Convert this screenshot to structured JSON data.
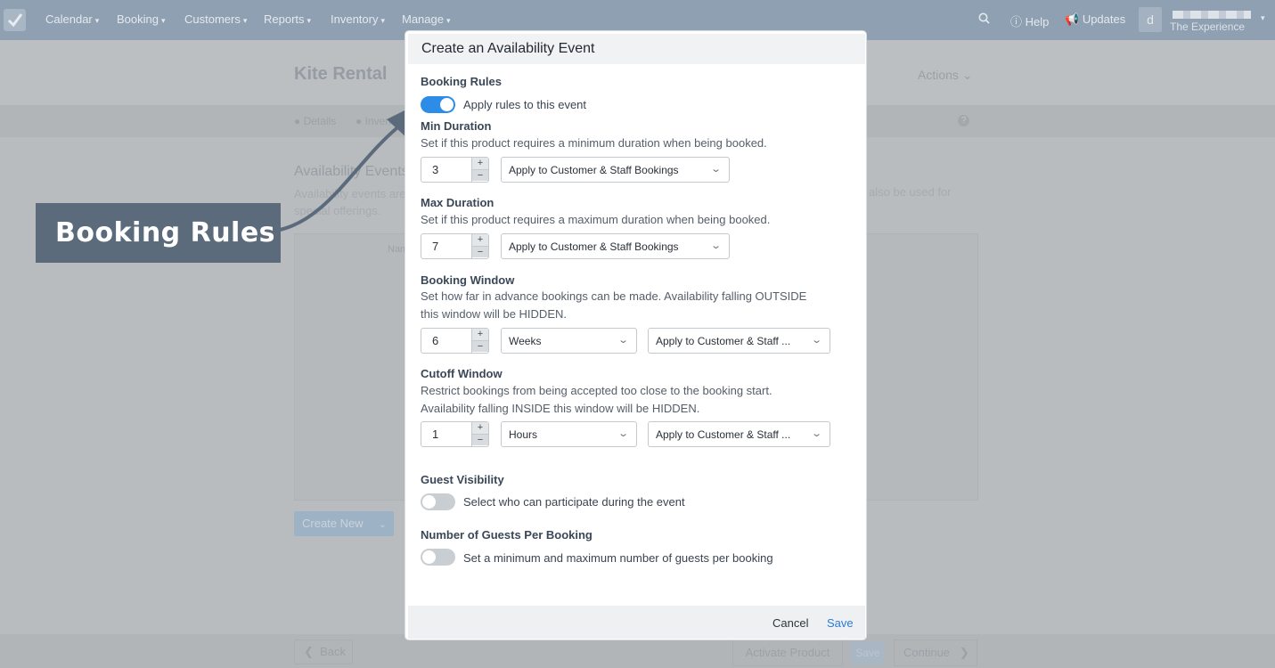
{
  "nav": {
    "items": [
      {
        "label": "Calendar"
      },
      {
        "label": "Booking"
      },
      {
        "label": "Customers"
      },
      {
        "label": "Reports"
      },
      {
        "label": "Inventory"
      },
      {
        "label": "Manage"
      }
    ],
    "help_label": "Help",
    "updates_label": "Updates",
    "avatar_letter": "d",
    "user_subtitle": "The Experience"
  },
  "background": {
    "title": "Kite Rental",
    "actions_label": "Actions",
    "steps": [
      "Details",
      "Inven"
    ],
    "section_title": "Availability Events",
    "description_lines": [
      "Availability events are",
      "special offerings."
    ],
    "description_right": "also be used for",
    "column_label": "Nam",
    "create_new_label": "Create New",
    "back_label": "Back",
    "activate_label": "Activate Product",
    "save_label": "Save",
    "continue_label": "Continue"
  },
  "callout": {
    "text": "Booking Rules",
    "color": "#5b6b7c"
  },
  "modal": {
    "title": "Create an Availability Event",
    "booking_rules": {
      "heading": "Booking Rules",
      "toggle_on": true,
      "toggle_label": "Apply rules to this event"
    },
    "min_duration": {
      "heading": "Min Duration",
      "description": "Set if this product requires a minimum duration when being booked.",
      "value": "3",
      "applies_to": "Apply to Customer & Staff Bookings"
    },
    "max_duration": {
      "heading": "Max Duration",
      "description": "Set if this product requires a maximum duration when being booked.",
      "value": "7",
      "applies_to": "Apply to Customer & Staff Bookings"
    },
    "booking_window": {
      "heading": "Booking Window",
      "description_1": "Set how far in advance bookings can be made. Availability falling OUTSIDE",
      "description_2": "this window will be HIDDEN.",
      "value": "6",
      "unit": "Weeks",
      "applies_to": "Apply to Customer & Staff ..."
    },
    "cutoff_window": {
      "heading": "Cutoff Window",
      "description_1": "Restrict bookings from being accepted too close to the booking start.",
      "description_2": "Availability falling INSIDE this window will be HIDDEN.",
      "value": "1",
      "unit": "Hours",
      "applies_to": "Apply to Customer & Staff ..."
    },
    "guest_visibility": {
      "heading": "Guest Visibility",
      "toggle_on": false,
      "toggle_label": "Select who can participate during the event"
    },
    "guests_per_booking": {
      "heading": "Number of Guests Per Booking",
      "toggle_on": false,
      "toggle_label": "Set a minimum and maximum number of guests per booking"
    },
    "cancel_label": "Cancel",
    "save_label": "Save"
  },
  "colors": {
    "accent": "#2d8ce8",
    "save_link": "#2b7bd8",
    "toggle_off": "#c9ced3"
  }
}
